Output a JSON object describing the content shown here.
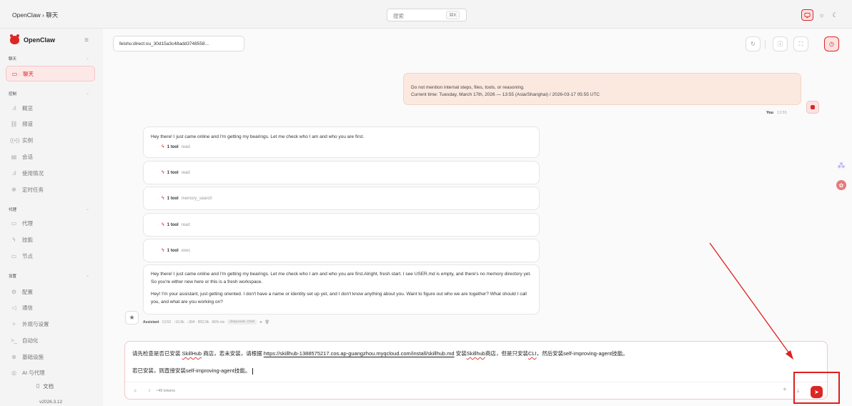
{
  "topbar": {
    "breadcrumb": "OpenClaw › 聊天",
    "search_placeholder": "搜索",
    "search_shortcut": "⌘K"
  },
  "sidebar": {
    "brand": "OpenClaw",
    "sections": [
      {
        "title": "聊天",
        "items": [
          {
            "label": "聊天",
            "icon": "chat-icon",
            "active": true
          }
        ]
      },
      {
        "title": "控制",
        "items": [
          {
            "label": "概览",
            "icon": "bar-chart-icon"
          },
          {
            "label": "频道",
            "icon": "link-icon"
          },
          {
            "label": "实例",
            "icon": "radio-icon"
          },
          {
            "label": "会话",
            "icon": "document-icon"
          },
          {
            "label": "使用情况",
            "icon": "bar-chart-icon"
          },
          {
            "label": "定时任务",
            "icon": "loader-icon"
          }
        ]
      },
      {
        "title": "代理",
        "items": [
          {
            "label": "代理",
            "icon": "folder-icon"
          },
          {
            "label": "技能",
            "icon": "bolt-icon"
          },
          {
            "label": "节点",
            "icon": "monitor-icon"
          }
        ]
      },
      {
        "title": "设置",
        "items": [
          {
            "label": "配置",
            "icon": "gear-icon"
          },
          {
            "label": "通信",
            "icon": "send-icon"
          },
          {
            "label": "外观与设置",
            "icon": "sparkle-icon"
          },
          {
            "label": "自动化",
            "icon": "terminal-icon"
          },
          {
            "label": "基础设施",
            "icon": "globe-icon"
          },
          {
            "label": "AI 与代理",
            "icon": "ai-icon"
          }
        ]
      }
    ],
    "docs": "文档",
    "version": "v2026.3.12"
  },
  "main": {
    "session_key": "feishu:direct:ou_30d15a3c48add3748558...",
    "user_message": {
      "lines": [
        "Do not mention internal steps, files, tools, or reasoning.",
        "Current time: Tuesday, March 17th, 2026 — 13:55 (Asia/Shanghai) / 2026-03-17 05:55 UTC"
      ],
      "sender": "You",
      "time": "13:55"
    },
    "assistant_messages": [
      {
        "text": "Hey there! I just came online and I'm getting my bearings. Let me check who I am and who you are first.",
        "tool_count": "1 tool",
        "tool_name": "read"
      },
      {
        "tool_count": "1 tool",
        "tool_name": "read"
      },
      {
        "tool_count": "1 tool",
        "tool_name": "memory_search"
      },
      {
        "tool_count": "1 tool",
        "tool_name": "read"
      },
      {
        "tool_count": "1 tool",
        "tool_name": "exec"
      }
    ],
    "final_message": {
      "p1": "Hey there! I just came online and I'm getting my bearings. Let me check who I am and who you are first.Alright, fresh start. I see USER.md is empty, and there's no memory directory yet. So you're either new here or this is a fresh workspace.",
      "p2": "Hey! I'm your assistant, just getting oriented. I don't have a name or identity set up yet, and I don't know anything about you. Want to figure out who we are together? What should I call you, and what are you working on?"
    },
    "meta": {
      "sender": "Assistant",
      "time": "13:53",
      "input": "↑10.6k",
      "output": "↓304",
      "cache": "R52.9k",
      "ctx": "66% ctx",
      "model": "deepseek-chat"
    },
    "composer": {
      "line1_a": "请先检查是否已安装 ",
      "line1_b": "SkillHub",
      "line1_c": " 商店，若未安装，请根据 ",
      "line1_url": "https://skillhub-1388575217.cos.ap-guangzhou.myqcloud.com/install/skillhub.md",
      "line1_d": " 安装",
      "line1_e": "Skillhub",
      "line1_f": "商店，但是只安装",
      "line1_g": "CLI",
      "line1_h": "，然后安装self-improving-agent技能。",
      "line2": "若已安装，则直接安装self-improving-agent技能。",
      "tokens": "~49 tokens"
    }
  },
  "colors": {
    "accent": "#dc2626",
    "annotation": "#e01e1e"
  }
}
